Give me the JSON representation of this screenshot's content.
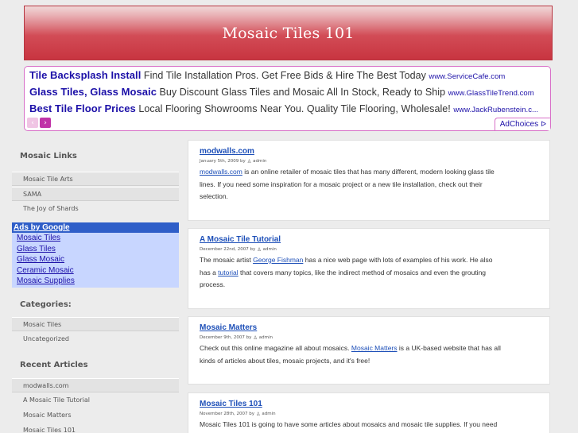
{
  "site": {
    "title": "Mosaic Tiles 101"
  },
  "ads": {
    "rows": [
      {
        "title": "Tile Backsplash Install",
        "text": " Find Tile Installation Pros. Get Free Bids & Hire The Best Today ",
        "url": "www.ServiceCafe.com"
      },
      {
        "title": "Glass Tiles, Glass Mosaic",
        "text": " Buy Discount Glass Tiles and Mosaic All In Stock, Ready to Ship ",
        "url": "www.GlassTileTrend.com"
      },
      {
        "title": "Best Tile Floor Prices",
        "text": " Local Flooring Showrooms Near You. Quality Tile Flooring, Wholesale! ",
        "url": "www.JackRubenstein.c..."
      }
    ],
    "prev_icon": "‹",
    "next_icon": "›",
    "adchoices": "AdChoices",
    "adchoices_icon": "ᐅ"
  },
  "sidebar": {
    "links_heading": "Mosaic Links",
    "links": [
      "Mosaic Tile Arts",
      "SAMA",
      "The Joy of Shards"
    ],
    "google_heading": "Ads by Google",
    "google_links": [
      "Mosaic Tiles",
      "Glass Tiles",
      "Glass Mosaic",
      "Ceramic Mosaic",
      "Mosaic Supplies"
    ],
    "categories_heading": "Categories:",
    "categories": [
      "Mosaic Tiles",
      "Uncategorized"
    ],
    "recent_heading": "Recent Articles",
    "recent": [
      "modwalls.com",
      "A Mosaic Tile Tutorial",
      "Mosaic Matters",
      "Mosaic Tiles 101"
    ]
  },
  "posts": [
    {
      "title": "modwalls.com",
      "date": "January 5th, 2009 by",
      "author": "admin",
      "line1_link": "modwalls.com",
      "line1_rest": " is an online retailer of mosaic tiles that has many different, modern looking glass tile",
      "line2": "lines. If you need some inspiration for a mosaic project or a new tile installation, check out their",
      "line3": "selection."
    },
    {
      "title": "A Mosaic Tile Tutorial",
      "date": "December 22nd, 2007 by",
      "author": "admin",
      "line1_pre": "The mosaic artist ",
      "line1_link": "George Fishman",
      "line1_rest": " has a nice web page with lots of examples of his work. He also",
      "line2_pre": "has a ",
      "line2_link": "tutorial",
      "line2_rest": " that covers many topics, like the indirect method of mosaics and even the grouting",
      "line3": "process."
    },
    {
      "title": "Mosaic Matters",
      "date": "December 9th, 2007 by",
      "author": "admin",
      "line1_pre": "Check out this online magazine all about mosaics. ",
      "line1_link": "Mosaic Matters",
      "line1_rest": " is a UK-based website that has all",
      "line2": "kinds of articles about tiles, mosaic projects, and it's free!"
    },
    {
      "title": "Mosaic Tiles 101",
      "date": "November 28th, 2007 by",
      "author": "admin",
      "line1": "Mosaic Tiles 101 is going to have some articles about mosaics and mosaic tile supplies. If you need"
    }
  ]
}
